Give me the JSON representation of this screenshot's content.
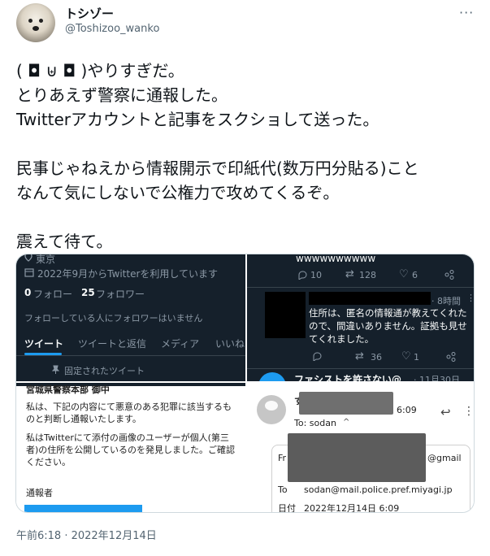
{
  "user": {
    "display_name": "トシゾー",
    "handle": "@Toshizoo_wanko"
  },
  "more_label": "···",
  "tweet_text": "( ◘ ⊎ ◘ )やりすぎだ。\nとりあえず警察に通報した。\nTwitterアカウントと記事をスクショして送った。\n\n民事じゃねえから情報開示で印紙代(数万円分貼る)こと\nなんて気にしないで公権力で攻めてくるぞ。\n\n震えて待て。",
  "timestamp": "午前6:18 · 2022年12月14日",
  "profile_shot": {
    "location": "東京",
    "joined": "2022年9月からTwitterを利用しています",
    "following_count": "0",
    "following_label": "フォロー",
    "followers_count": "25",
    "followers_label": "フォロワー",
    "no_mutuals": "フォローしている人にフォロワーはいません",
    "tabs": [
      "ツイート",
      "ツイートと返信",
      "メディア",
      "いいね"
    ],
    "pinned": "固定されたツイート"
  },
  "reply_shot": {
    "top_text": "wwwwwwwwww",
    "top_reply": "10",
    "top_rt": "128",
    "top_like": "6",
    "time": "· 8時間",
    "body": "住所は、匿名の情報通が教えてくれたので、間違いありません。証拠も見せてくれました。",
    "reply": "",
    "rt": "36",
    "like": "1",
    "next_user": "ファシストを許さない@",
    "next_date": "· 11月30日"
  },
  "document_shot": {
    "addressee": "宮城県警察本部 御中",
    "p1": "私は、下記の内容にて悪意のある犯罪に該当するものと判断し通報いたします。",
    "p2": "私はTwitterにて添付の画像のユーザーが個人(第三者)の住所を公開しているのを発見しました。ご確認ください。",
    "reporter": "通報者"
  },
  "email_shot": {
    "time": "6:09",
    "to_line": "To: sodan",
    "from_label": "Fr",
    "from_suffix": "@gmail",
    "to_label": "To",
    "to_value": "sodan@mail.police.pref.miyagi.jp",
    "date_label": "日付",
    "date_value": "2022年12月14日 6:09"
  }
}
